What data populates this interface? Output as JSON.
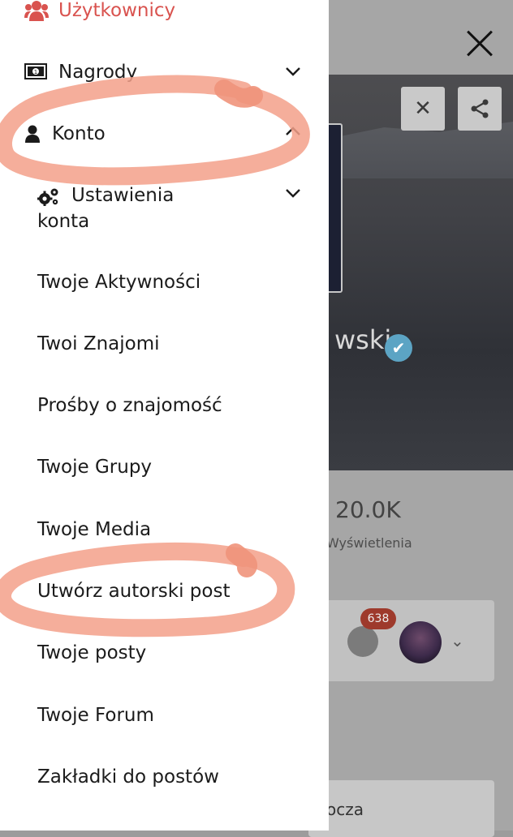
{
  "drawer": {
    "section_header": "Użytkownicy",
    "items": [
      {
        "label": "Nagrody",
        "icon": "banknote-icon",
        "chevron": "chevron-down-icon"
      },
      {
        "label": "Konto",
        "icon": "user-icon",
        "chevron": "chevron-up-icon"
      }
    ],
    "account_settings": {
      "label_line1": "Ustawienia",
      "label_line2": "konta",
      "icon": "gears-icon"
    },
    "submenu": [
      "Twoje Aktywności",
      "Twoi Znajomi",
      "Prośby o znajomość",
      "Twoje Grupy",
      "Twoje Media",
      "Utwórz autorski post",
      "Twoje posty",
      "Twoje Forum",
      "Zakładki do postów"
    ]
  },
  "background": {
    "profile_name_fragment": "wski",
    "views_count": "20.0K",
    "views_label": "Wyświetlenia",
    "notification_count": "638",
    "card_text_fragment": "ocza"
  },
  "colors": {
    "accent": "#d9534f",
    "highlight_stroke": "#f3a08a",
    "drawer_bg": "#ffffff",
    "overlay": "#a6a6a6"
  }
}
